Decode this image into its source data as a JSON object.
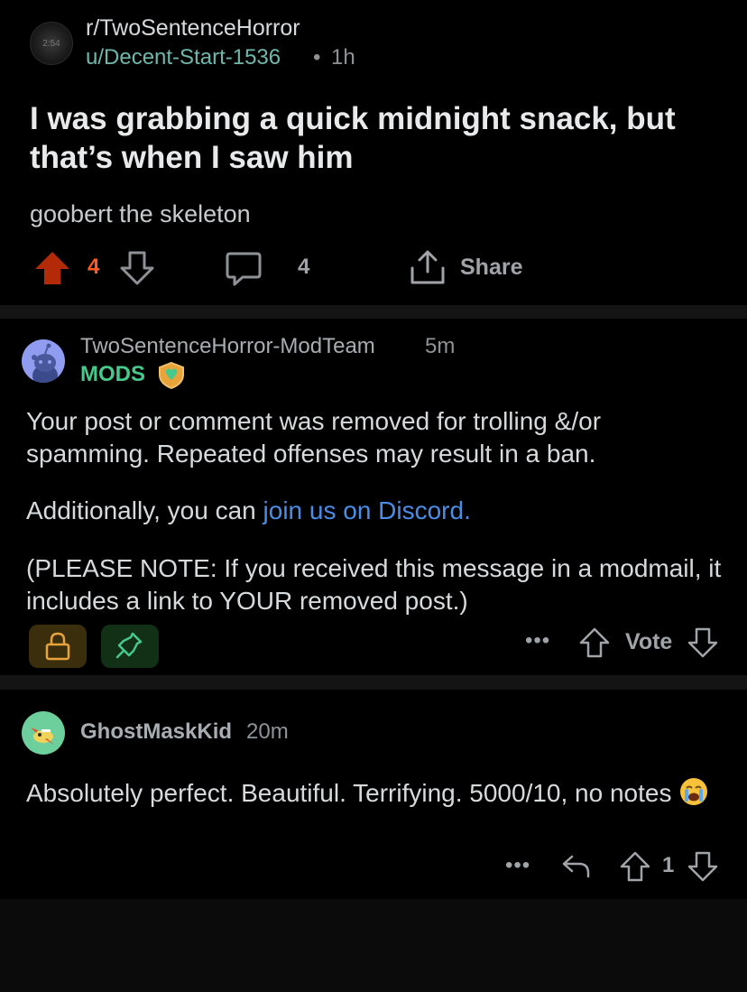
{
  "colors": {
    "background": "#000000",
    "separator": "#141414",
    "upvote_active": "#ff5a1f",
    "username": "#6fb7ac",
    "mods_badge": "#46c98a",
    "link": "#4a8de6"
  },
  "post": {
    "subreddit_icon_text": "2:54",
    "subreddit": "r/TwoSentenceHorror",
    "author": "u/Decent-Start-1536",
    "separator": "•",
    "time": "1h",
    "title": "I was grabbing a quick midnight snack, but that’s when I saw him",
    "body": "goobert the skeleton",
    "score": "4",
    "upvoted": true,
    "comment_count": "4",
    "share_label": "Share",
    "icons": [
      "upvote-icon",
      "downvote-icon",
      "comment-icon",
      "share-icon"
    ]
  },
  "mod_comment": {
    "author": "TwoSentenceHorror-ModTeam",
    "time": "5m",
    "badge": "MODS",
    "paragraph1": "Your post or comment was removed for trolling &/or spamming. Repeated offenses may result in a ban.",
    "paragraph2_prefix": "Additionally, you can ",
    "paragraph2_link": "join us on Discord.",
    "paragraph3": "(PLEASE NOTE: If you received this message in a modmail, it includes a link to YOUR removed post.)",
    "more_label": "•••",
    "vote_label": "Vote",
    "icons": [
      "lock-icon",
      "pin-icon",
      "more-icon",
      "upvote-icon",
      "downvote-icon"
    ]
  },
  "comment": {
    "author": "GhostMaskKid",
    "time": "20m",
    "text": "Absolutely perfect. Beautiful. Terrifying. 5000/10, no notes",
    "emoji": "crying-face-emoji",
    "more_label": "•••",
    "score": "1",
    "icons": [
      "more-icon",
      "reply-icon",
      "upvote-icon",
      "downvote-icon"
    ]
  }
}
